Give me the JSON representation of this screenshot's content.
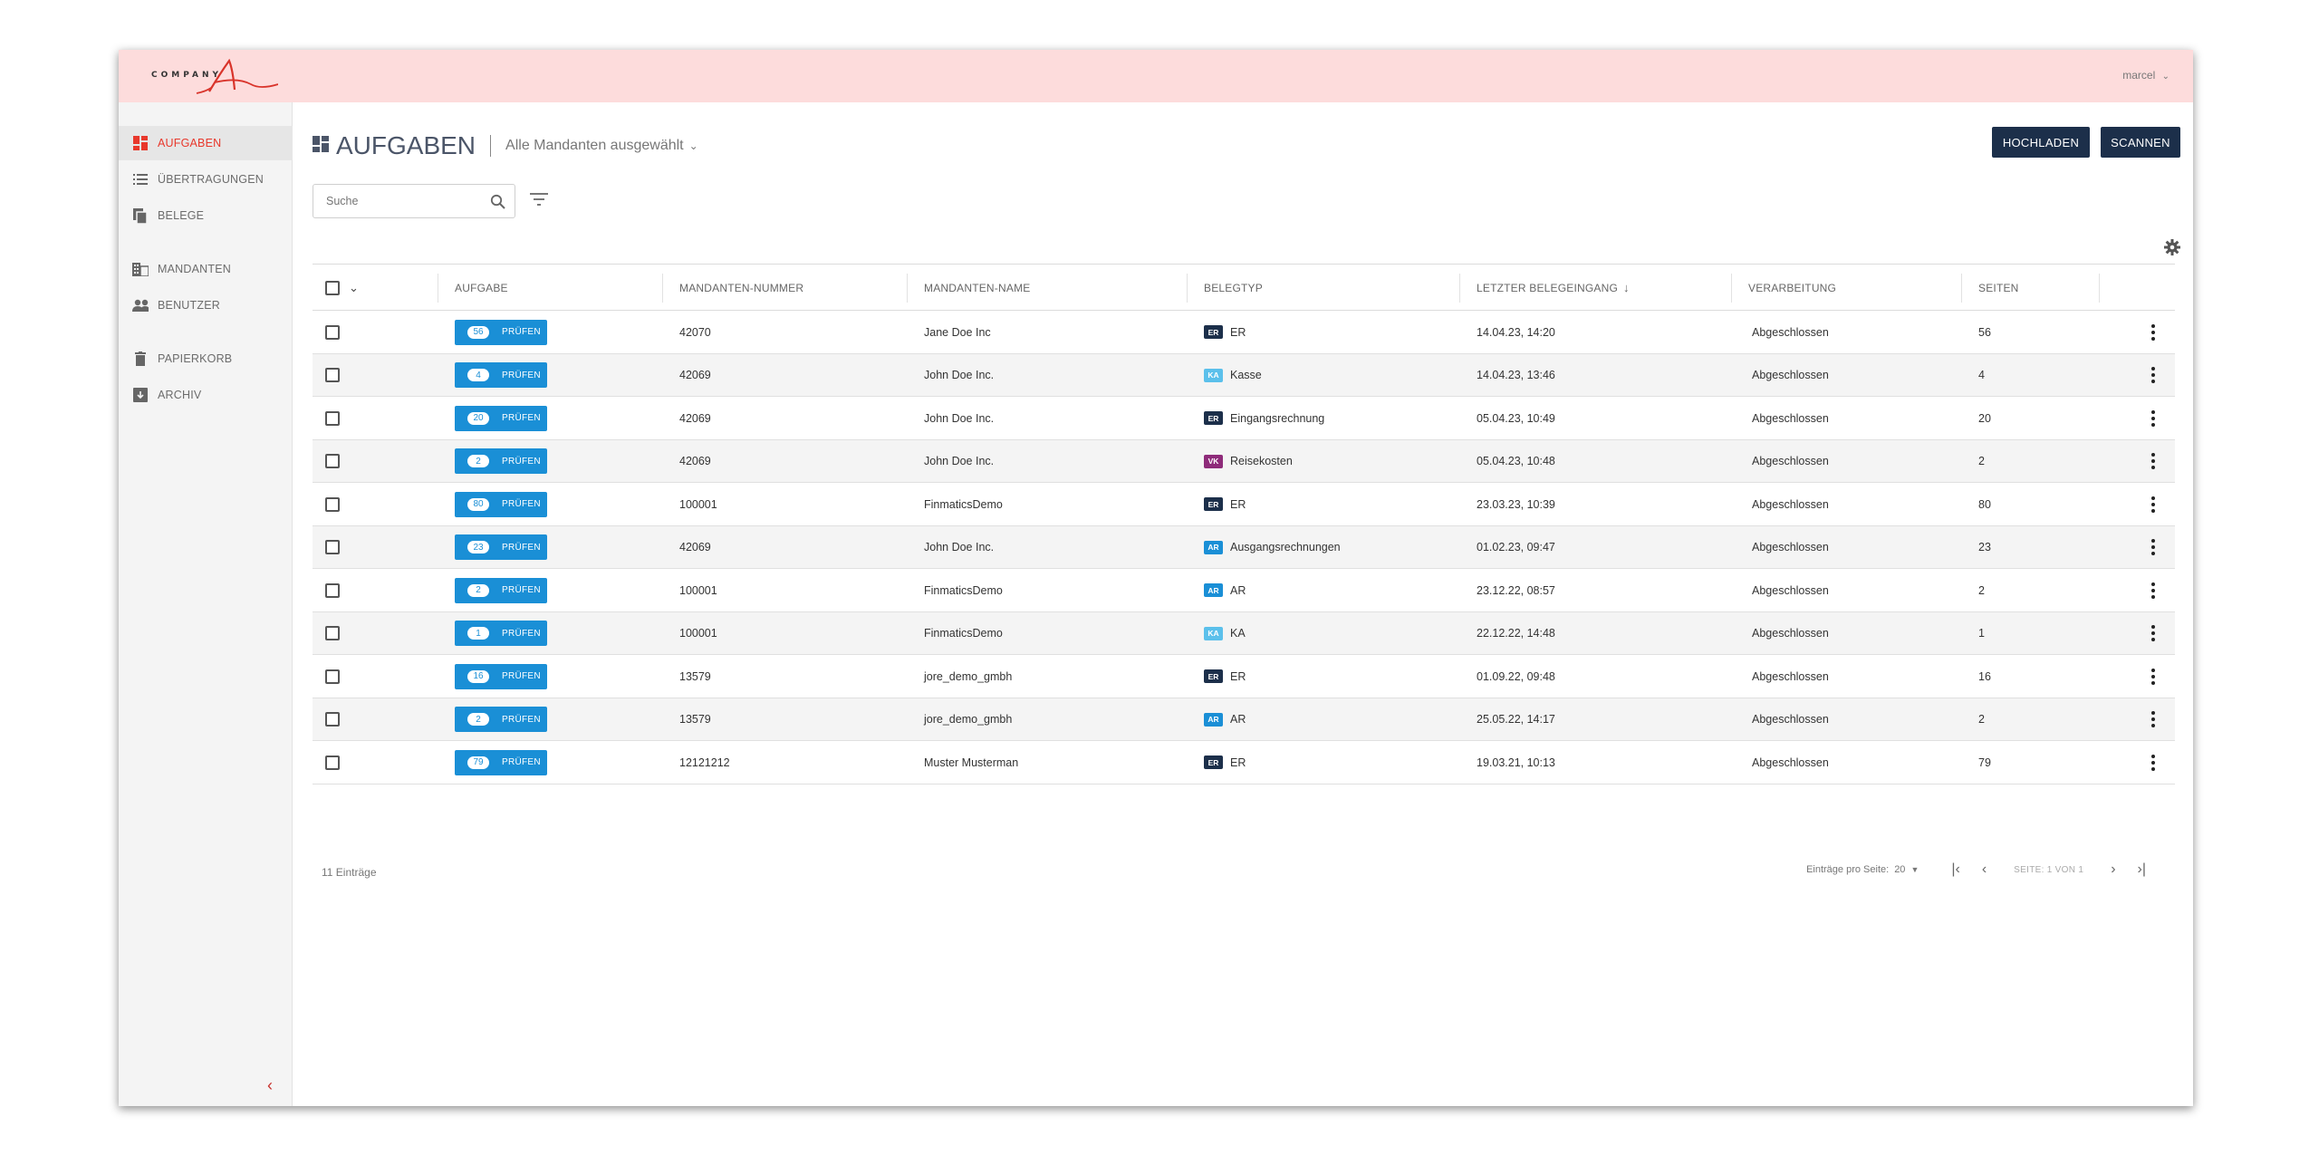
{
  "brand": {
    "logo_text": "COMPANY",
    "logo_letter": "A"
  },
  "header": {
    "user_label": "marcel"
  },
  "sidebar": {
    "items": [
      {
        "label": "AUFGABEN",
        "icon": "dashboard-icon",
        "active": true
      },
      {
        "label": "ÜBERTRAGUNGEN",
        "icon": "list-icon"
      },
      {
        "label": "BELEGE",
        "icon": "documents-icon"
      },
      {
        "label": "MANDANTEN",
        "icon": "building-icon"
      },
      {
        "label": "BENUTZER",
        "icon": "people-icon"
      },
      {
        "label": "PAPIERKORB",
        "icon": "trash-icon"
      },
      {
        "label": "ARCHIV",
        "icon": "archive-icon"
      }
    ]
  },
  "page": {
    "title": "AUFGABEN",
    "mandant_select": "Alle Mandanten ausgewählt",
    "upload_label": "HOCHLADEN",
    "scan_label": "SCANNEN",
    "search_placeholder": "Suche"
  },
  "table": {
    "columns": [
      "AUFGABE",
      "MANDANTEN-NUMMER",
      "MANDANTEN-NAME",
      "BELEGTYP",
      "LETZTER BELEGEINGANG",
      "VERARBEITUNG",
      "SEITEN"
    ],
    "action_label": "PRÜFEN",
    "rows": [
      {
        "count": "56",
        "nummer": "42070",
        "name": "Jane Doe Inc",
        "badge": "ER",
        "badge_color": "#1c2f4a",
        "belegtyp": "ER",
        "eingang": "14.04.23, 14:20",
        "verarbeitung": "Abgeschlossen",
        "seiten": "56"
      },
      {
        "count": "4",
        "nummer": "42069",
        "name": "John Doe Inc.",
        "badge": "KA",
        "badge_color": "#5bc0eb",
        "belegtyp": "Kasse",
        "eingang": "14.04.23, 13:46",
        "verarbeitung": "Abgeschlossen",
        "seiten": "4"
      },
      {
        "count": "20",
        "nummer": "42069",
        "name": "John Doe Inc.",
        "badge": "ER",
        "badge_color": "#1c2f4a",
        "belegtyp": "Eingangsrechnung",
        "eingang": "05.04.23, 10:49",
        "verarbeitung": "Abgeschlossen",
        "seiten": "20"
      },
      {
        "count": "2",
        "nummer": "42069",
        "name": "John Doe Inc.",
        "badge": "VK",
        "badge_color": "#8e2b7a",
        "belegtyp": "Reisekosten",
        "eingang": "05.04.23, 10:48",
        "verarbeitung": "Abgeschlossen",
        "seiten": "2"
      },
      {
        "count": "80",
        "nummer": "100001",
        "name": "FinmaticsDemo",
        "badge": "ER",
        "badge_color": "#1c2f4a",
        "belegtyp": "ER",
        "eingang": "23.03.23, 10:39",
        "verarbeitung": "Abgeschlossen",
        "seiten": "80"
      },
      {
        "count": "23",
        "nummer": "42069",
        "name": "John Doe Inc.",
        "badge": "AR",
        "badge_color": "#1a8fd6",
        "belegtyp": "Ausgangsrechnungen",
        "eingang": "01.02.23, 09:47",
        "verarbeitung": "Abgeschlossen",
        "seiten": "23"
      },
      {
        "count": "2",
        "nummer": "100001",
        "name": "FinmaticsDemo",
        "badge": "AR",
        "badge_color": "#1a8fd6",
        "belegtyp": "AR",
        "eingang": "23.12.22, 08:57",
        "verarbeitung": "Abgeschlossen",
        "seiten": "2"
      },
      {
        "count": "1",
        "nummer": "100001",
        "name": "FinmaticsDemo",
        "badge": "KA",
        "badge_color": "#5bc0eb",
        "belegtyp": "KA",
        "eingang": "22.12.22, 14:48",
        "verarbeitung": "Abgeschlossen",
        "seiten": "1"
      },
      {
        "count": "16",
        "nummer": "13579",
        "name": "jore_demo_gmbh",
        "badge": "ER",
        "badge_color": "#1c2f4a",
        "belegtyp": "ER",
        "eingang": "01.09.22, 09:48",
        "verarbeitung": "Abgeschlossen",
        "seiten": "16"
      },
      {
        "count": "2",
        "nummer": "13579",
        "name": "jore_demo_gmbh",
        "badge": "AR",
        "badge_color": "#1a8fd6",
        "belegtyp": "AR",
        "eingang": "25.05.22, 14:17",
        "verarbeitung": "Abgeschlossen",
        "seiten": "2"
      },
      {
        "count": "79",
        "nummer": "12121212",
        "name": "Muster Musterman",
        "badge": "ER",
        "badge_color": "#1c2f4a",
        "belegtyp": "ER",
        "eingang": "19.03.21, 10:13",
        "verarbeitung": "Abgeschlossen",
        "seiten": "79"
      }
    ]
  },
  "footer": {
    "entries_label": "11 Einträge",
    "per_page_label": "Einträge pro Seite:",
    "per_page_value": "20",
    "page_info": "SEITE: 1 VON 1"
  },
  "colors": {
    "accent_red": "#e8382c",
    "primary_dark": "#1c2f4a",
    "action_blue": "#1a8fd6",
    "topbar": "#fddcdc"
  }
}
